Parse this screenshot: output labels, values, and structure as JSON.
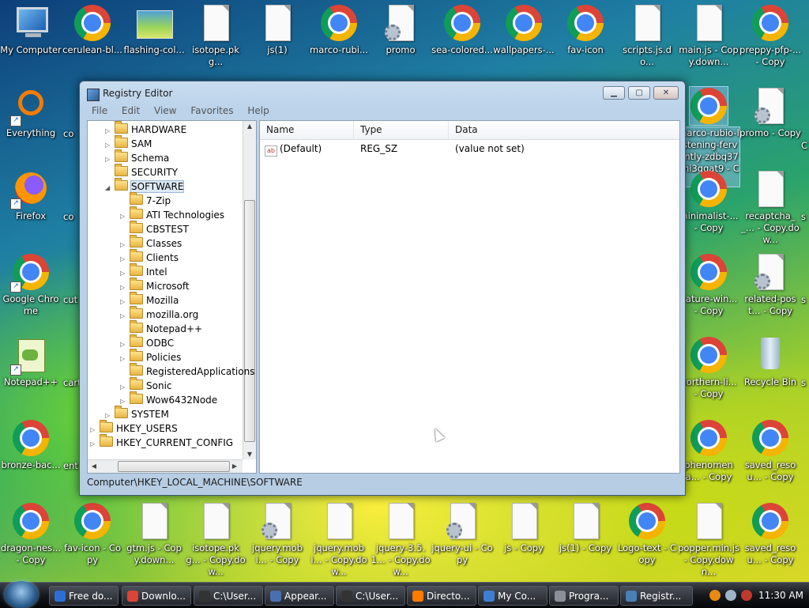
{
  "desktop": {
    "icons": [
      {
        "label": "My Computer",
        "kind": "monitor"
      },
      {
        "label": "cerulean-bl...",
        "kind": "chrome"
      },
      {
        "label": "flashing-col...",
        "kind": "flash"
      },
      {
        "label": "isotope.pkg...",
        "kind": "doc"
      },
      {
        "label": "js(1)",
        "kind": "doc"
      },
      {
        "label": "marco-rubi...",
        "kind": "chrome"
      },
      {
        "label": "promo",
        "kind": "gear"
      },
      {
        "label": "sea-colored...",
        "kind": "chrome"
      },
      {
        "label": "wallpapers-...",
        "kind": "chrome"
      },
      {
        "label": "fav-icon",
        "kind": "chrome"
      },
      {
        "label": "scripts.js.do...",
        "kind": "doc"
      },
      {
        "label": "main.js - Copy.down...",
        "kind": "doc"
      },
      {
        "label": "preppy-pfp-... - Copy",
        "kind": "chrome"
      },
      {
        "label": "Everything",
        "kind": "ring"
      },
      {
        "label": "Firefox",
        "kind": "firefox"
      },
      {
        "label": "Google Chrome",
        "kind": "chrome"
      },
      {
        "label": "Notepad++",
        "kind": "notepad"
      },
      {
        "label": "bronze-bac...",
        "kind": "chrome"
      },
      {
        "label": "marco-rubio-listening-fervently-zdbq37yhi3ggat9 - Copy",
        "kind": "chrome"
      },
      {
        "label": "promo - Copy",
        "kind": "gear"
      },
      {
        "label": "minimalist-... - Copy",
        "kind": "chrome"
      },
      {
        "label": "recaptcha__... - Copy.dow...",
        "kind": "doc"
      },
      {
        "label": "nature-win... - Copy",
        "kind": "chrome"
      },
      {
        "label": "related-post... - Copy",
        "kind": "gear"
      },
      {
        "label": "northern-li... - Copy",
        "kind": "chrome"
      },
      {
        "label": "Recycle Bin",
        "kind": "bin"
      },
      {
        "label": "phenomena... - Copy",
        "kind": "chrome"
      },
      {
        "label": "saved_resou... - Copy",
        "kind": "chrome"
      },
      {
        "label": "dragon-nes... - Copy",
        "kind": "chrome"
      },
      {
        "label": "fav-icon - Copy",
        "kind": "chrome"
      },
      {
        "label": "gtm.js - Copy.down...",
        "kind": "doc"
      },
      {
        "label": "isotope.pkg... - Copy.dow...",
        "kind": "doc"
      },
      {
        "label": "jquery.mobi... - Copy",
        "kind": "gear"
      },
      {
        "label": "jquery.mobi... - Copy.dow...",
        "kind": "doc"
      },
      {
        "label": "jquery-3.5.1... - Copy.dow...",
        "kind": "doc"
      },
      {
        "label": "jquery-ui - Copy",
        "kind": "gear"
      },
      {
        "label": "js - Copy",
        "kind": "doc"
      },
      {
        "label": "js(1) - Copy",
        "kind": "doc"
      },
      {
        "label": "Logo-text - Copy",
        "kind": "chrome"
      },
      {
        "label": "popper.min.js - Copy.down...",
        "kind": "doc"
      },
      {
        "label": "saved_resou... - Copy",
        "kind": "chrome"
      }
    ],
    "partial_labels": [
      "co",
      "co",
      "cut",
      "cart",
      "ent",
      "s",
      "s",
      "s",
      "C"
    ]
  },
  "window": {
    "title": "Registry Editor",
    "menu": [
      "File",
      "Edit",
      "View",
      "Favorites",
      "Help"
    ],
    "tree": [
      {
        "label": "HARDWARE",
        "indent": 1,
        "exp": "▷"
      },
      {
        "label": "SAM",
        "indent": 1,
        "exp": "▷"
      },
      {
        "label": "Schema",
        "indent": 1,
        "exp": "▷"
      },
      {
        "label": "SECURITY",
        "indent": 1,
        "exp": ""
      },
      {
        "label": "SOFTWARE",
        "indent": 1,
        "exp": "◢",
        "selected": true
      },
      {
        "label": "7-Zip",
        "indent": 2,
        "exp": ""
      },
      {
        "label": "ATI Technologies",
        "indent": 2,
        "exp": "▷"
      },
      {
        "label": "CBSTEST",
        "indent": 2,
        "exp": ""
      },
      {
        "label": "Classes",
        "indent": 2,
        "exp": "▷"
      },
      {
        "label": "Clients",
        "indent": 2,
        "exp": "▷"
      },
      {
        "label": "Intel",
        "indent": 2,
        "exp": "▷"
      },
      {
        "label": "Microsoft",
        "indent": 2,
        "exp": "▷"
      },
      {
        "label": "Mozilla",
        "indent": 2,
        "exp": "▷"
      },
      {
        "label": "mozilla.org",
        "indent": 2,
        "exp": "▷"
      },
      {
        "label": "Notepad++",
        "indent": 2,
        "exp": ""
      },
      {
        "label": "ODBC",
        "indent": 2,
        "exp": "▷"
      },
      {
        "label": "Policies",
        "indent": 2,
        "exp": "▷"
      },
      {
        "label": "RegisteredApplications",
        "indent": 2,
        "exp": ""
      },
      {
        "label": "Sonic",
        "indent": 2,
        "exp": "▷"
      },
      {
        "label": "Wow6432Node",
        "indent": 2,
        "exp": "▷"
      },
      {
        "label": "SYSTEM",
        "indent": 1,
        "exp": "▷"
      },
      {
        "label": "HKEY_USERS",
        "indent": 0,
        "exp": "▷"
      },
      {
        "label": "HKEY_CURRENT_CONFIG",
        "indent": 0,
        "exp": "▷"
      }
    ],
    "columns": [
      "Name",
      "Type",
      "Data"
    ],
    "values": [
      {
        "name": "(Default)",
        "type": "REG_SZ",
        "data": "(value not set)"
      }
    ],
    "status": "Computer\\HKEY_LOCAL_MACHINE\\SOFTWARE"
  },
  "taskbar": {
    "items": [
      {
        "label": "Free do...",
        "color": "#2b6fd6"
      },
      {
        "label": "Downlo...",
        "color": "#db4437"
      },
      {
        "label": "C:\\User...",
        "color": "#333333"
      },
      {
        "label": "Appear...",
        "color": "#4a6fb0"
      },
      {
        "label": "C:\\User...",
        "color": "#333333"
      },
      {
        "label": "Directo...",
        "color": "#ff7a00"
      },
      {
        "label": "My Co...",
        "color": "#3c7fd0"
      },
      {
        "label": "Progra...",
        "color": "#8a8f99"
      },
      {
        "label": "Registr...",
        "color": "#4a7fb8"
      }
    ],
    "clock": "11:30 AM"
  }
}
